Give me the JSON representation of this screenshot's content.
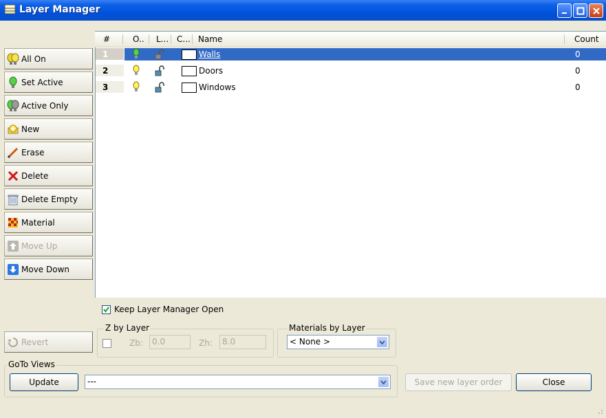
{
  "window": {
    "title": "Layer Manager"
  },
  "columns": [
    "#",
    "O..",
    "L...",
    "C...",
    "Name",
    "Count"
  ],
  "layers": [
    {
      "num": "1",
      "name": "Walls",
      "count": "0",
      "on": true,
      "active": true
    },
    {
      "num": "2",
      "name": "Doors",
      "count": "0",
      "on": true,
      "active": false
    },
    {
      "num": "3",
      "name": "Windows",
      "count": "0",
      "on": true,
      "active": false
    }
  ],
  "toolbar": {
    "all_on": "All On",
    "set_active": "Set Active",
    "active_only": "Active Only",
    "new": "New",
    "erase": "Erase",
    "delete": "Delete",
    "delete_empty": "Delete Empty",
    "material": "Material",
    "move_up": "Move Up",
    "move_down": "Move Down"
  },
  "keep_open": {
    "label": "Keep Layer Manager Open",
    "checked": true
  },
  "revert": "Revert",
  "z_by_layer": {
    "label": "Z by Layer",
    "zb_label": "Zb:",
    "zb_value": "0.0",
    "zh_label": "Zh:",
    "zh_value": "8.0"
  },
  "materials_by_layer": {
    "label": "Materials by Layer",
    "value": "< None >"
  },
  "goto_views": {
    "label": "GoTo Views",
    "update": "Update",
    "value": "---"
  },
  "save_order": "Save new layer order",
  "close": "Close",
  "colors": {
    "title_blue": "#0a5fe6",
    "selection": "#316ac5",
    "face": "#ece9d8"
  }
}
